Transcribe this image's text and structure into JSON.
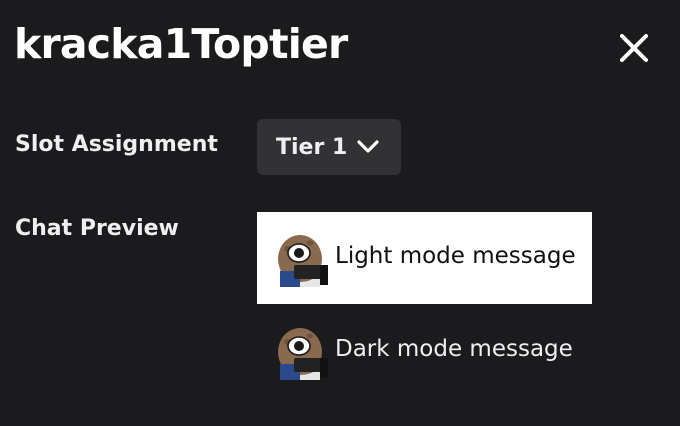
{
  "header": {
    "title": "kracka1Toptier",
    "close_icon": "close-icon"
  },
  "slot_assignment": {
    "label": "Slot Assignment",
    "selected_value": "Tier 1",
    "chevron_icon": "chevron-down-icon"
  },
  "chat_preview": {
    "label": "Chat Preview",
    "emote_icon": "emote-image",
    "light": {
      "message": "Light mode message",
      "background": "#ffffff",
      "text_color": "#0e0e10"
    },
    "dark": {
      "message": "Dark mode message",
      "background": "#1b1b1d",
      "text_color": "#efeff1"
    }
  },
  "colors": {
    "background": "#1b1b1d",
    "dropdown_background": "#323235",
    "text": "#efeff1"
  }
}
